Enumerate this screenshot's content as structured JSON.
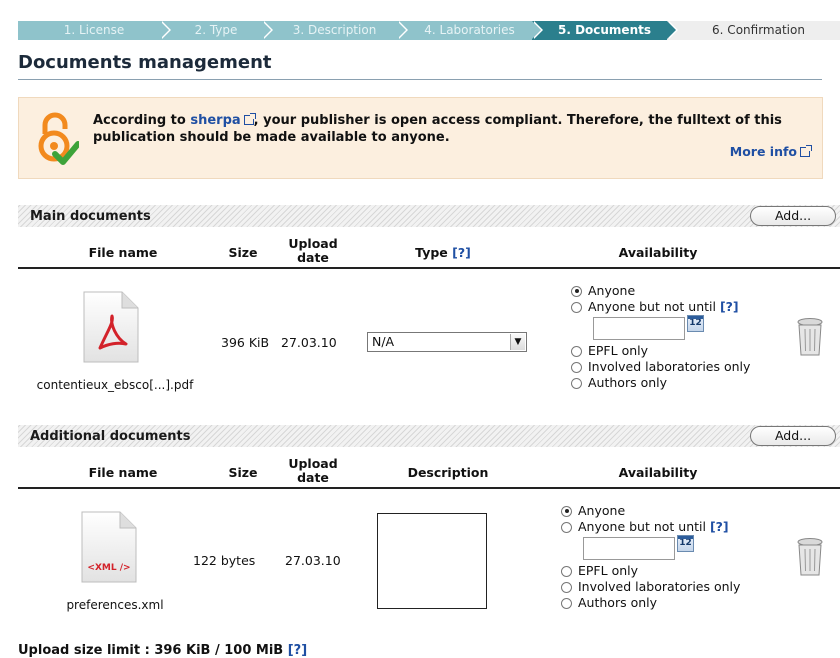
{
  "steps": [
    {
      "label": "1. License"
    },
    {
      "label": "2. Type"
    },
    {
      "label": "3. Description"
    },
    {
      "label": "4. Laboratories"
    },
    {
      "label": "5. Documents"
    },
    {
      "label": "6. Confirmation"
    }
  ],
  "page_title": "Documents management",
  "notice": {
    "text_before": "According to ",
    "sherpa_link": "sherpa",
    "text_after": ", your publisher is open access compliant. Therefore, the fulltext of this publication should be made available to anyone.",
    "more_info": "More info"
  },
  "main": {
    "section_label": "Main documents",
    "add_label": "Add...",
    "headers": {
      "file_name": "File name",
      "size": "Size",
      "upload_date_1": "Upload",
      "upload_date_2": "date",
      "type": "Type",
      "type_help": "[?]",
      "availability": "Availability"
    },
    "row": {
      "file_name": "contentieux_ebsco[...].pdf",
      "file_icon_label": "",
      "size": "396 KiB",
      "date": "27.03.10",
      "type_value": "N/A"
    }
  },
  "additional": {
    "section_label": "Additional documents",
    "add_label": "Add...",
    "headers": {
      "file_name": "File name",
      "size": "Size",
      "upload_date_1": "Upload",
      "upload_date_2": "date",
      "description": "Description",
      "availability": "Availability"
    },
    "row": {
      "file_name": "preferences.xml",
      "file_icon_label": "<XML />",
      "size": "122 bytes",
      "date": "27.03.10"
    }
  },
  "availability_options": {
    "anyone": "Anyone",
    "not_until": "Anyone but not until",
    "not_until_help": "[?]",
    "calendar": "12",
    "epfl": "EPFL only",
    "labs": "Involved laboratories only",
    "authors": "Authors only"
  },
  "footer": {
    "text": "Upload size limit : 396 KiB / 100 MiB",
    "help": "[?]"
  },
  "colors": {
    "step_inactive": "#8fc3cb",
    "step_active": "#2b7f8d",
    "notice_bg": "#fcefdf",
    "link": "#1f4fa3"
  }
}
